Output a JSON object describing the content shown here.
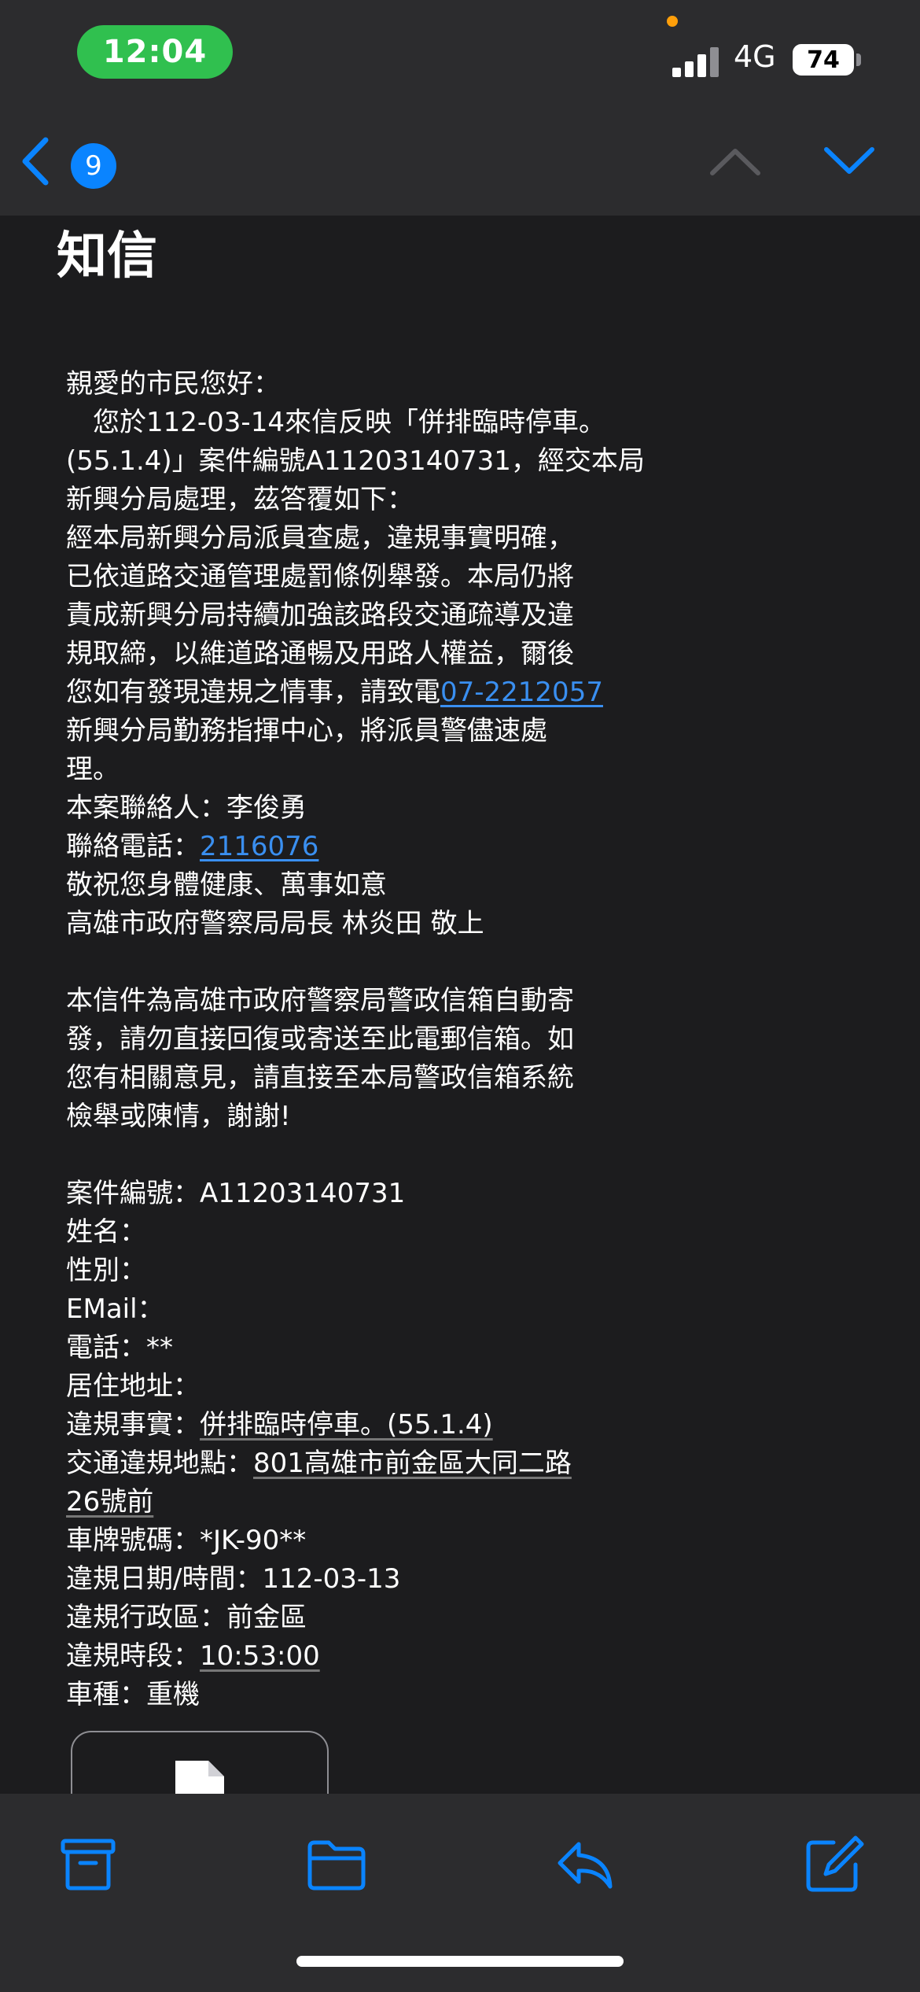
{
  "status_bar": {
    "time": "12:04",
    "network": "4G",
    "battery": "74"
  },
  "nav": {
    "unread_count": "9",
    "icons": [
      "chevron-left-icon",
      "chevron-up-icon",
      "chevron-down-icon"
    ],
    "accent_color": "#0a84ff"
  },
  "email": {
    "subject": "知信",
    "greeting": "親愛的市民您好：",
    "p1": "　您於112-03-14來信反映「併排臨時停車。",
    "p2": "(55.1.4)」案件編號A11203140731，經交本局",
    "p3": "新興分局處理，茲答覆如下：",
    "p4": "經本局新興分局派員查處，違規事實明確，",
    "p5": "已依道路交通管理處罰條例舉發。本局仍將",
    "p6": "責成新興分局持續加強該路段交通疏導及違",
    "p7": "規取締，以維道路通暢及用路人權益，爾後",
    "p8_prefix": "您如有發現違規之情事，請致電",
    "phone_link": "07-2212057",
    "p9": "新興分局勤務指揮中心，將派員警儘速處",
    "p10": "理。",
    "contact": "本案聯絡人：李俊勇",
    "contact_phone_label": "聯絡電話：",
    "contact_phone": "2116076",
    "wishes": "敬祝您身體健康、萬事如意",
    "signature": "高雄市政府警察局局長 林炎田 敬上",
    "notice1": "本信件為高雄市政府警察局警政信箱自動寄",
    "notice2": "發，請勿直接回復或寄送至此電郵信箱。如",
    "notice3": "您有相關意見，請直接至本局警政信箱系統",
    "notice4": "檢舉或陳情，謝謝!",
    "case_no": "案件編號：A11203140731",
    "name_label": "姓名：",
    "gender_label": "性別：",
    "email_label": "EMail：",
    "phone_label": "電話：**",
    "address_label": "居住地址：",
    "violation_label": "違規事實：",
    "violation_value": "併排臨時停車。(55.1.4)",
    "location_label": "交通違規地點：",
    "location_value_1": "801高雄市前金區大同二路",
    "location_value_2": "26號前",
    "plate": "車牌號碼：*JK-90**",
    "date_label": "違規日期/時間：",
    "date_value": "112-03-13",
    "district": "違規行政區：前金區",
    "period_label": "違規時段：",
    "period_value": "10:53:00",
    "vehicle": "車種：重機"
  },
  "attachment": {
    "icon": "document-icon"
  },
  "toolbar": {
    "icons": [
      "archive-icon",
      "folder-icon",
      "reply-icon",
      "compose-icon"
    ]
  }
}
